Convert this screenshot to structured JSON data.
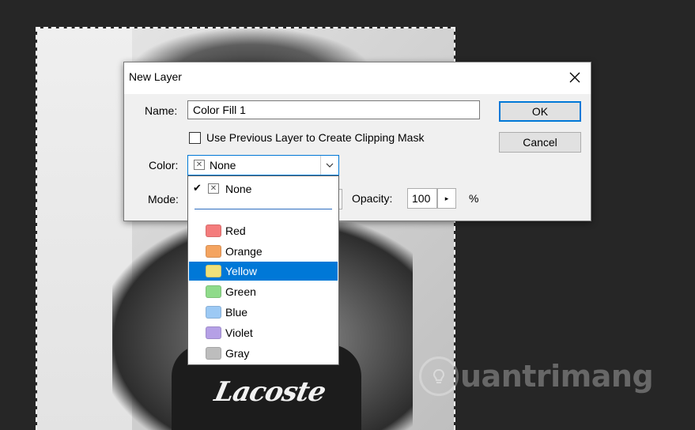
{
  "dialog": {
    "title": "New Layer",
    "name_label": "Name:",
    "name_value": "Color Fill 1",
    "clipping_label": "Use Previous Layer to Create Clipping Mask",
    "clipping_checked": false,
    "color_label": "Color:",
    "color_value": "None",
    "mode_label": "Mode:",
    "opacity_label": "Opacity:",
    "opacity_value": "100",
    "opacity_unit": "%",
    "ok_label": "OK",
    "cancel_label": "Cancel"
  },
  "color_dropdown": {
    "items": [
      {
        "label": "None",
        "checked": true,
        "swatch": "none"
      },
      {
        "label": "Red",
        "color": "#f47c7c"
      },
      {
        "label": "Orange",
        "color": "#f4a460"
      },
      {
        "label": "Yellow",
        "color": "#f0e17a",
        "selected": true
      },
      {
        "label": "Green",
        "color": "#8fdb8a"
      },
      {
        "label": "Blue",
        "color": "#9cc9f4"
      },
      {
        "label": "Violet",
        "color": "#b5a0e6"
      },
      {
        "label": "Gray",
        "color": "#bdbdbd"
      }
    ]
  },
  "canvas": {
    "shirt_text": "Lacoste"
  },
  "watermark": {
    "text": "uantrimang"
  },
  "colors": {
    "accent": "#0078d7",
    "dialog_bg": "#f0f0f0",
    "workspace_bg": "#262626"
  }
}
